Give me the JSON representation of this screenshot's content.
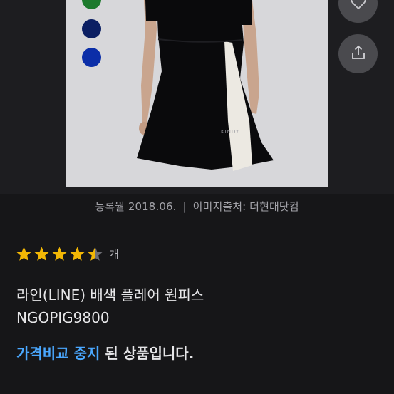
{
  "product": {
    "caption_registered": "등록월 2018.06.",
    "caption_separator": "|",
    "caption_source": "이미지출처: 더현대닷컴",
    "image_brand_text": "KINDY",
    "rating_stars": 4.5,
    "rating_unit": "개",
    "name": "라인(LINE) 배색 플레어 원피스",
    "model_code": "NGOPIG9800",
    "notice_highlight": "가격비교 중지",
    "notice_rest": " 된 상품입니다."
  },
  "swatches": [
    {
      "name": "green",
      "color": "#1c7a2c"
    },
    {
      "name": "navy",
      "color": "#0b1f63"
    },
    {
      "name": "royal-blue",
      "color": "#0b2ea8"
    }
  ],
  "actions": [
    {
      "name": "wishlist",
      "icon": "heart-icon"
    },
    {
      "name": "share",
      "icon": "share-icon"
    }
  ],
  "colors": {
    "background": "#161618",
    "accent": "#4aa8ff",
    "star": "#f2b705"
  }
}
